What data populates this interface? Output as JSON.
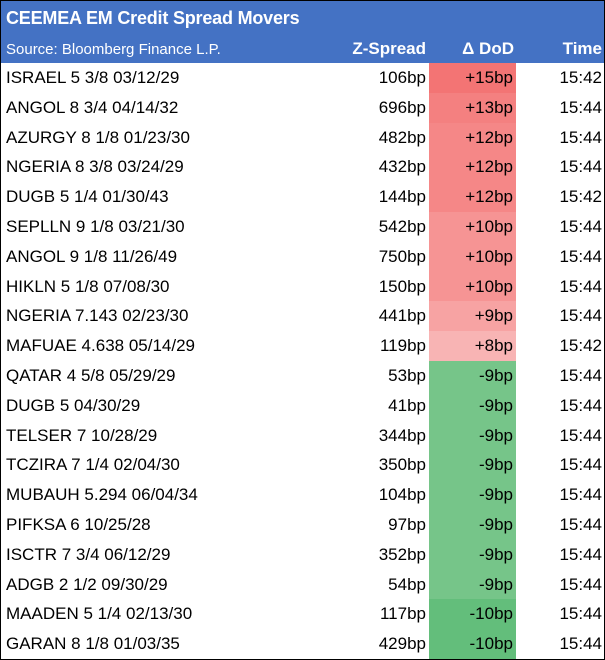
{
  "title": "CEEMEA EM Credit Spread Movers",
  "source": "Source: Bloomberg Finance L.P.",
  "columns": {
    "spread": "Z-Spread",
    "dod": "Δ DoD",
    "time": "Time"
  },
  "colors": {
    "header_bg": "#4472c4",
    "header_text": "#ffffff",
    "widen_strongest": "#f37474",
    "widen_weakest": "#f8b4b4",
    "tighten_strong": "#63be7b",
    "tighten_base": "#76c589"
  },
  "rows": [
    {
      "name": "ISRAEL 5 3/8 03/12/29",
      "spread": "106bp",
      "dod": "+15bp",
      "time": "15:42",
      "bg": "#f37474"
    },
    {
      "name": "ANGOL 8 3/4 04/14/32",
      "spread": "696bp",
      "dod": "+13bp",
      "time": "15:44",
      "bg": "#f48080"
    },
    {
      "name": "AZURGY 8 1/8 01/23/30",
      "spread": "482bp",
      "dod": "+12bp",
      "time": "15:44",
      "bg": "#f58787"
    },
    {
      "name": "NGERIA 8 3/8 03/24/29",
      "spread": "432bp",
      "dod": "+12bp",
      "time": "15:44",
      "bg": "#f58787"
    },
    {
      "name": "DUGB 5 1/4 01/30/43",
      "spread": "144bp",
      "dod": "+12bp",
      "time": "15:42",
      "bg": "#f58787"
    },
    {
      "name": "SEPLLN 9 1/8 03/21/30",
      "spread": "542bp",
      "dod": "+10bp",
      "time": "15:44",
      "bg": "#f69494"
    },
    {
      "name": "ANGOL 9 1/8 11/26/49",
      "spread": "750bp",
      "dod": "+10bp",
      "time": "15:44",
      "bg": "#f69494"
    },
    {
      "name": "HIKLN 5 1/8 07/08/30",
      "spread": "150bp",
      "dod": "+10bp",
      "time": "15:44",
      "bg": "#f69494"
    },
    {
      "name": "NGERIA 7.143 02/23/30",
      "spread": "441bp",
      "dod": "+9bp",
      "time": "15:44",
      "bg": "#f7a3a3"
    },
    {
      "name": "MAFUAE 4.638 05/14/29",
      "spread": "119bp",
      "dod": "+8bp",
      "time": "15:42",
      "bg": "#f8b4b4"
    },
    {
      "name": "QATAR 4 5/8 05/29/29",
      "spread": "53bp",
      "dod": "-9bp",
      "time": "15:44",
      "bg": "#76c589"
    },
    {
      "name": "DUGB 5 04/30/29",
      "spread": "41bp",
      "dod": "-9bp",
      "time": "15:44",
      "bg": "#76c589"
    },
    {
      "name": "TELSER 7 10/28/29",
      "spread": "344bp",
      "dod": "-9bp",
      "time": "15:44",
      "bg": "#76c589"
    },
    {
      "name": "TCZIRA 7 1/4 02/04/30",
      "spread": "350bp",
      "dod": "-9bp",
      "time": "15:44",
      "bg": "#76c589"
    },
    {
      "name": "MUBAUH 5.294 06/04/34",
      "spread": "104bp",
      "dod": "-9bp",
      "time": "15:44",
      "bg": "#76c589"
    },
    {
      "name": "PIFKSA 6 10/25/28",
      "spread": "97bp",
      "dod": "-9bp",
      "time": "15:44",
      "bg": "#76c589"
    },
    {
      "name": "ISCTR 7 3/4 06/12/29",
      "spread": "352bp",
      "dod": "-9bp",
      "time": "15:44",
      "bg": "#76c589"
    },
    {
      "name": "ADGB 2 1/2 09/30/29",
      "spread": "54bp",
      "dod": "-9bp",
      "time": "15:44",
      "bg": "#76c589"
    },
    {
      "name": "MAADEN 5 1/4 02/13/30",
      "spread": "117bp",
      "dod": "-10bp",
      "time": "15:44",
      "bg": "#63be7b"
    },
    {
      "name": "GARAN 8 1/8 01/03/35",
      "spread": "429bp",
      "dod": "-10bp",
      "time": "15:44",
      "bg": "#63be7b"
    }
  ]
}
